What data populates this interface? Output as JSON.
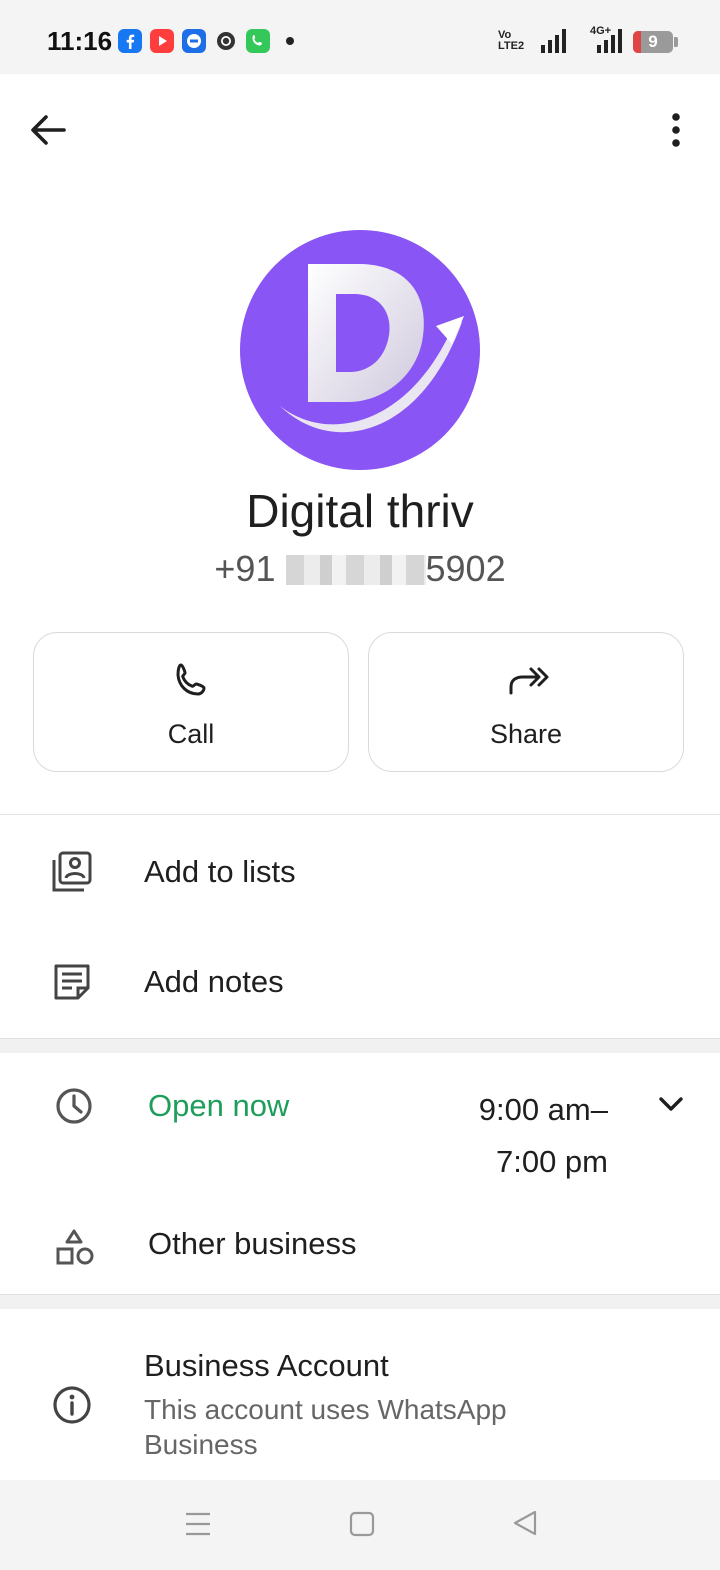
{
  "status_bar": {
    "time": "11:16",
    "volte_line1": "Vo",
    "volte_line2": "LTE2",
    "network": "4G+",
    "battery": "9",
    "battery_level_percent": 9,
    "notification_icons": [
      "facebook-icon",
      "youtube-icon",
      "app-icon",
      "chrome-icon",
      "phone-icon"
    ]
  },
  "header": {
    "back_icon": "arrow-left-icon",
    "menu_icon": "more-vert-icon"
  },
  "profile": {
    "name": "Digital thriv",
    "phone_prefix": "+91",
    "phone_suffix": "5902",
    "avatar_color": "#8a55f5"
  },
  "actions": [
    {
      "label": "Call",
      "icon": "phone-icon"
    },
    {
      "label": "Share",
      "icon": "share-icon"
    }
  ],
  "menu": [
    {
      "label": "Add to lists",
      "icon": "contact-list-icon"
    },
    {
      "label": "Add notes",
      "icon": "note-icon"
    }
  ],
  "business_hours": {
    "status": "Open now",
    "status_color": "#1e9e5a",
    "hours_line1": "9:00 am–",
    "hours_line2": "7:00 pm"
  },
  "category": {
    "label": "Other business",
    "icon": "shapes-icon"
  },
  "business_account": {
    "title": "Business Account",
    "subtitle": "This account uses WhatsApp Business",
    "icon": "info-icon"
  },
  "nav_bar": {
    "icons": [
      "menu-icon",
      "home-square-icon",
      "back-triangle-icon"
    ]
  }
}
